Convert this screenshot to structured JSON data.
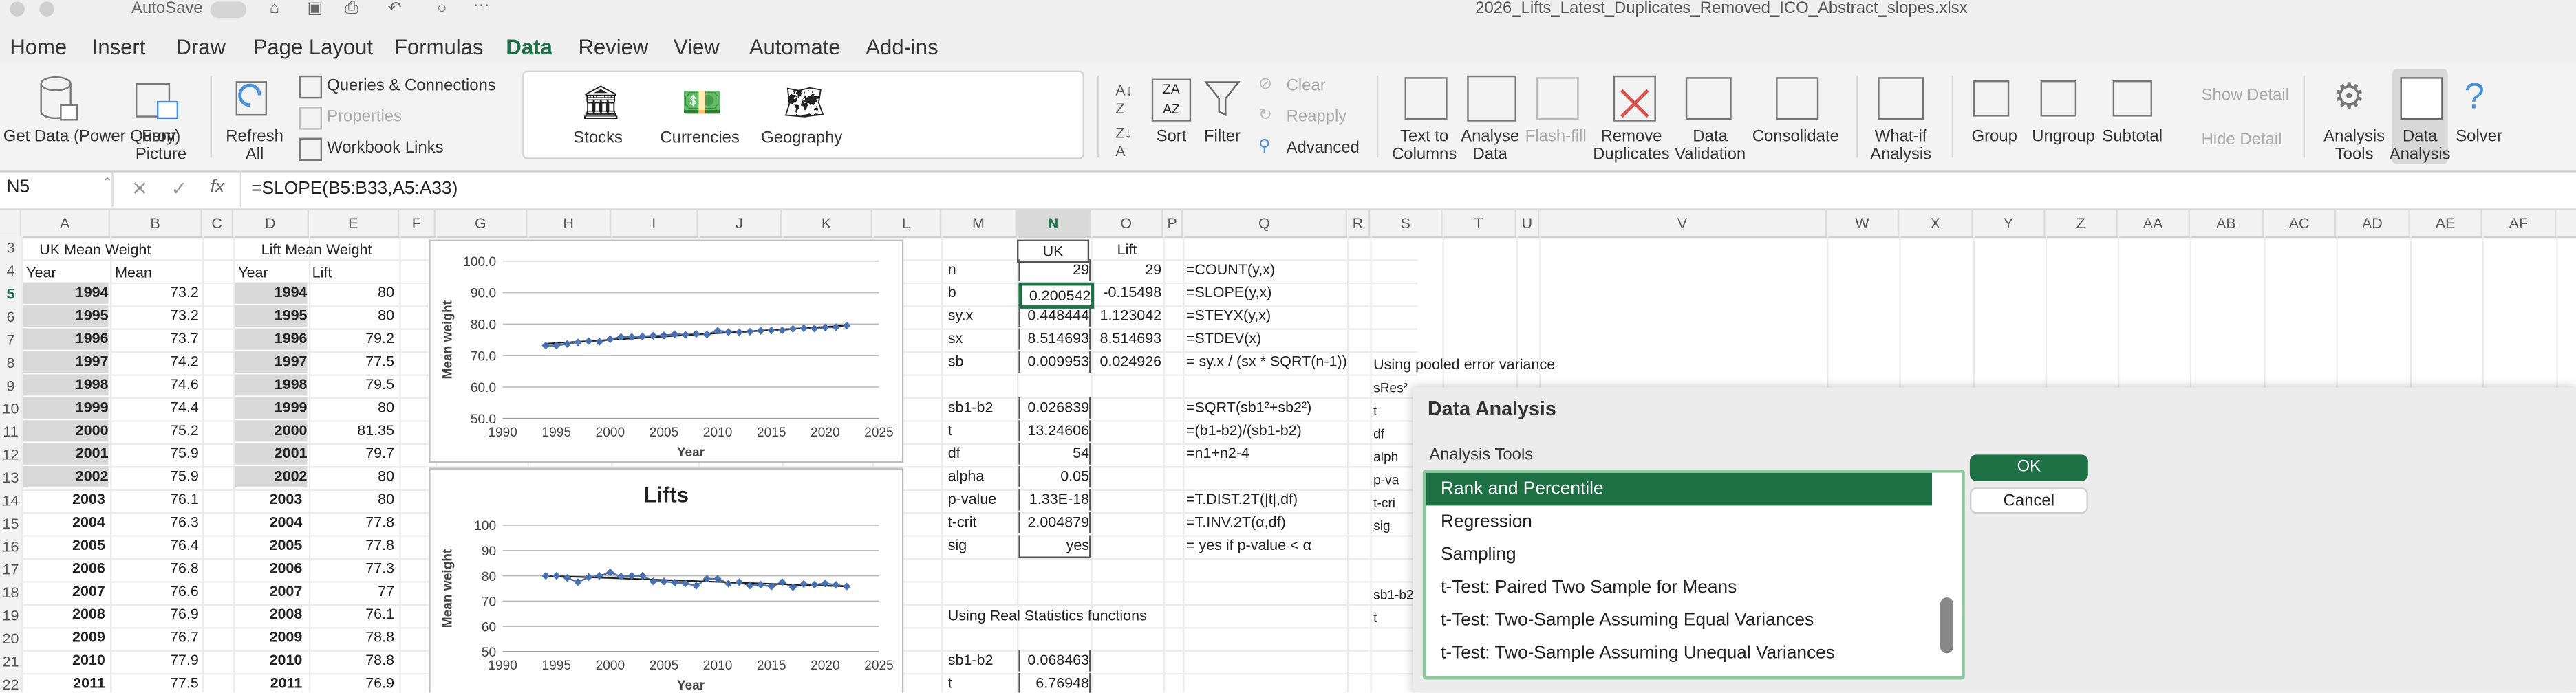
{
  "window": {
    "autosave_label": "AutoSave",
    "file_title": "2026_Lifts_Latest_Duplicates_Removed_ICO_Abstract_slopes.xlsx"
  },
  "tabs": [
    "Home",
    "Insert",
    "Draw",
    "Page Layout",
    "Formulas",
    "Data",
    "Review",
    "View",
    "Automate",
    "Add-ins"
  ],
  "ribbon": {
    "get_data": "Get Data (Power Query)",
    "from_picture": "From Picture",
    "refresh_all": "Refresh All",
    "queries_connections": "Queries & Connections",
    "properties": "Properties",
    "workbook_links": "Workbook Links",
    "stocks": "Stocks",
    "currencies": "Currencies",
    "geography": "Geography",
    "sort": "Sort",
    "filter": "Filter",
    "clear": "Clear",
    "reapply": "Reapply",
    "advanced": "Advanced",
    "text_to_columns": "Text to Columns",
    "analyse_data": "Analyse Data",
    "flash_fill": "Flash-fill",
    "remove_duplicates": "Remove Duplicates",
    "data_validation": "Data Validation",
    "consolidate": "Consolidate",
    "what_if": "What-if Analysis",
    "group": "Group",
    "ungroup": "Ungroup",
    "subtotal": "Subtotal",
    "show_detail": "Show Detail",
    "hide_detail": "Hide Detail",
    "analysis_tools": "Analysis Tools",
    "data_analysis": "Data Analysis",
    "solver": "Solver"
  },
  "formula_bar": {
    "name_box": "N5",
    "fx": "fx",
    "formula": "=SLOPE(B5:B33,A5:A33)"
  },
  "columns": [
    "A",
    "B",
    "C",
    "D",
    "E",
    "F",
    "G",
    "H",
    "I",
    "J",
    "K",
    "L",
    "M",
    "N",
    "O",
    "P",
    "Q",
    "R",
    "S",
    "T",
    "U",
    "V",
    "W",
    "X",
    "Y",
    "Z",
    "AA",
    "AB",
    "AC",
    "AD",
    "AE",
    "AF"
  ],
  "rows": [
    "3",
    "4",
    "5",
    "6",
    "7",
    "8",
    "9",
    "10",
    "11",
    "12",
    "13",
    "14",
    "15",
    "16",
    "17",
    "18",
    "19",
    "20",
    "21",
    "22"
  ],
  "sheet": {
    "uk_header": "UK Mean Weight",
    "lift_header": "Lift Mean Weight",
    "year_label": "Year",
    "mean_label": "Mean",
    "lift_label": "Lift",
    "uk_years": [
      "1994",
      "1995",
      "1996",
      "1997",
      "1998",
      "1999",
      "2000",
      "2001",
      "2002",
      "2003",
      "2004",
      "2005",
      "2006",
      "2007",
      "2008",
      "2009",
      "2010",
      "2011"
    ],
    "uk_means": [
      "73.2",
      "73.2",
      "73.7",
      "74.2",
      "74.6",
      "74.4",
      "75.2",
      "75.9",
      "75.9",
      "76.1",
      "76.3",
      "76.4",
      "76.8",
      "76.6",
      "76.9",
      "76.7",
      "77.9",
      "77.5"
    ],
    "lift_years": [
      "1994",
      "1995",
      "1996",
      "1997",
      "1998",
      "1999",
      "2000",
      "2001",
      "2002",
      "2003",
      "2004",
      "2005",
      "2006",
      "2007",
      "2008",
      "2009",
      "2010",
      "2011"
    ],
    "lift_values": [
      "80",
      "80",
      "79.2",
      "77.5",
      "79.5",
      "80",
      "81.35",
      "79.7",
      "80",
      "80",
      "77.8",
      "77.8",
      "77.3",
      "77",
      "76.1",
      "78.8",
      "78.8",
      "76.9"
    ],
    "stats_header_uk": "UK",
    "stats_header_lift": "Lift",
    "stats": [
      {
        "label": "n",
        "uk": "29",
        "lift": "29",
        "formula": "=COUNT(y,x)"
      },
      {
        "label": "b",
        "uk": "0.200542",
        "lift": "-0.15498",
        "formula": "=SLOPE(y,x)"
      },
      {
        "label": "sy.x",
        "uk": "0.448444",
        "lift": "1.123042",
        "formula": "=STEYX(y,x)"
      },
      {
        "label": "sx",
        "uk": "8.514693",
        "lift": "8.514693",
        "formula": "=STDEV(x)"
      },
      {
        "label": "sb",
        "uk": "0.009953",
        "lift": "0.024926",
        "formula": "= sy.x / (sx * SQRT(n-1))"
      },
      {
        "label": "",
        "uk": "",
        "lift": "",
        "formula": ""
      },
      {
        "label": "sb1-b2",
        "uk": "0.026839",
        "lift": "",
        "formula": "=SQRT(sb1²+sb2²)"
      },
      {
        "label": "t",
        "uk": "13.24606",
        "lift": "",
        "formula": "=(b1-b2)/(sb1-b2)"
      },
      {
        "label": "df",
        "uk": "54",
        "lift": "",
        "formula": "=n1+n2-4"
      },
      {
        "label": "alpha",
        "uk": "0.05",
        "lift": "",
        "formula": ""
      },
      {
        "label": "p-value",
        "uk": "1.33E-18",
        "lift": "",
        "formula": "=T.DIST.2T(|t|,df)"
      },
      {
        "label": "t-crit",
        "uk": "2.004879",
        "lift": "",
        "formula": "=T.INV.2T(α,df)"
      },
      {
        "label": "sig",
        "uk": "yes",
        "lift": "",
        "formula": "= yes if p-value < α"
      }
    ],
    "real_stats_label": "Using Real Statistics functions",
    "real_stats": [
      {
        "label": "sb1-b2",
        "value": "0.068463"
      },
      {
        "label": "t",
        "value": "6.76948"
      }
    ],
    "pooled_label": "Using pooled error variance",
    "s_col_labels": [
      "sRes²",
      "t",
      "df",
      "alph",
      "p-va",
      "t-cri",
      "sig",
      "",
      "",
      "sb1-b2",
      "t"
    ]
  },
  "chart1": {
    "type": "line",
    "ylabel": "Mean weight",
    "xlabel": "Year",
    "yticks": [
      "50.0",
      "60.0",
      "70.0",
      "80.0",
      "90.0",
      "100.0"
    ],
    "xticks": [
      "1990",
      "1995",
      "2000",
      "2005",
      "2010",
      "2015",
      "2020",
      "2025"
    ]
  },
  "chart2": {
    "type": "line",
    "title": "Lifts",
    "ylabel": "Mean weight",
    "xlabel": "Year",
    "yticks": [
      "50",
      "60",
      "70",
      "80",
      "90",
      "100"
    ],
    "xticks": [
      "1990",
      "1995",
      "2000",
      "2005",
      "2010",
      "2015",
      "2020",
      "2025"
    ]
  },
  "chart_data": [
    {
      "type": "line",
      "title": "",
      "xlabel": "Year",
      "ylabel": "Mean weight",
      "xlim": [
        1990,
        2025
      ],
      "ylim": [
        50,
        100
      ],
      "x": [
        1994,
        1995,
        1996,
        1997,
        1998,
        1999,
        2000,
        2001,
        2002,
        2003,
        2004,
        2005,
        2006,
        2007,
        2008,
        2009,
        2010,
        2011,
        2012,
        2013,
        2014,
        2015,
        2016,
        2017,
        2018,
        2019,
        2020,
        2021,
        2022
      ],
      "series": [
        {
          "values": [
            73.2,
            73.2,
            73.7,
            74.2,
            74.6,
            74.4,
            75.2,
            75.9,
            75.9,
            76.1,
            76.3,
            76.4,
            76.8,
            76.6,
            76.9,
            76.7,
            77.9,
            77.5,
            77.4,
            77.6,
            77.9,
            78.0,
            78.0,
            78.5,
            78.7,
            78.6,
            78.9,
            79.0,
            79.5
          ]
        }
      ],
      "trendline": true,
      "grid": true
    },
    {
      "type": "line",
      "title": "Lifts",
      "xlabel": "Year",
      "ylabel": "Mean weight",
      "xlim": [
        1990,
        2025
      ],
      "ylim": [
        50,
        100
      ],
      "x": [
        1994,
        1995,
        1996,
        1997,
        1998,
        1999,
        2000,
        2001,
        2002,
        2003,
        2004,
        2005,
        2006,
        2007,
        2008,
        2009,
        2010,
        2011,
        2012,
        2013,
        2014,
        2015,
        2016,
        2017,
        2018,
        2019,
        2020,
        2021,
        2022
      ],
      "series": [
        {
          "values": [
            80,
            80,
            79.2,
            77.5,
            79.5,
            80,
            81.35,
            79.7,
            80,
            80,
            77.8,
            77.8,
            77.3,
            77,
            76.1,
            78.8,
            78.8,
            76.9,
            77.5,
            76.2,
            76.5,
            75.8,
            77.5,
            75.5,
            76.8,
            76.5,
            77.0,
            76.4,
            75.8
          ]
        }
      ],
      "trendline": true,
      "grid": true
    }
  ],
  "dialog": {
    "title": "Data Analysis",
    "subtitle": "Analysis Tools",
    "items": [
      "Rank and Percentile",
      "Regression",
      "Sampling",
      "t-Test: Paired Two Sample for Means",
      "t-Test: Two-Sample Assuming Equal Variances",
      "t-Test: Two-Sample Assuming Unequal Variances"
    ],
    "selected_index": 0,
    "ok_label": "OK",
    "cancel_label": "Cancel"
  },
  "colors": {
    "accent": "#1e7145",
    "series": "#4a72b0",
    "trend": "#222222"
  }
}
